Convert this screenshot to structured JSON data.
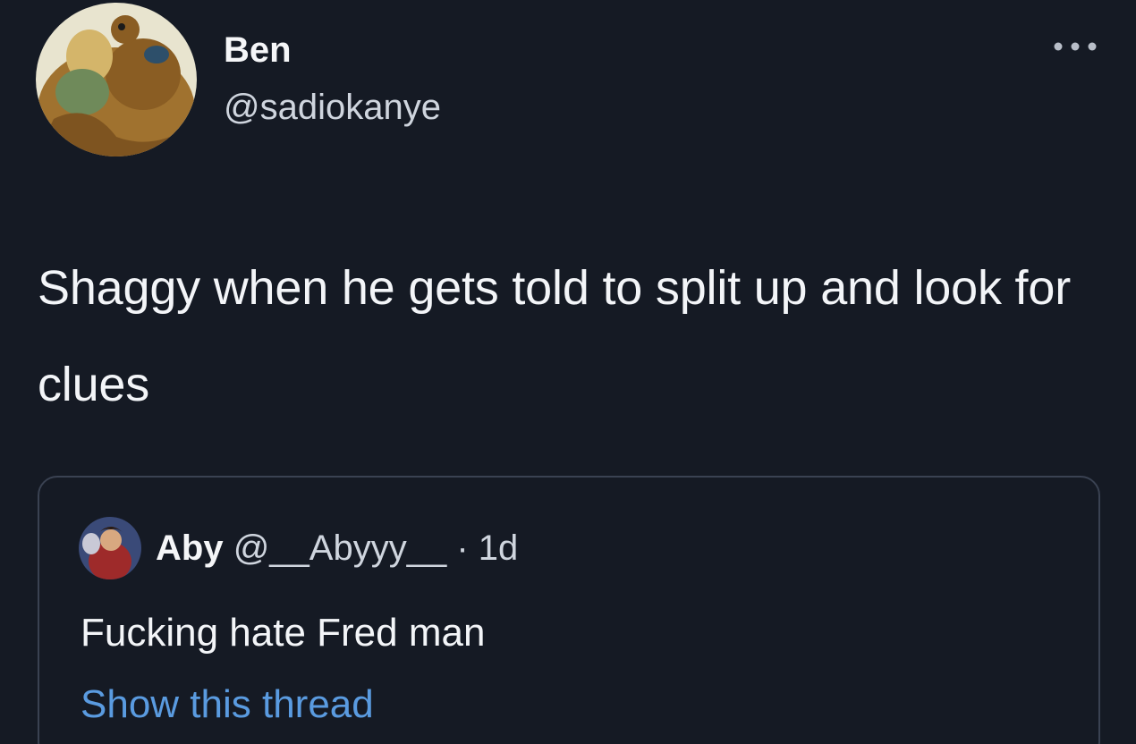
{
  "tweet": {
    "avatar_icon": "scooby-shaggy-avatar-icon",
    "display_name": "Ben",
    "handle": "@sadiokanye",
    "more_icon": "more-options-icon",
    "text": "Shaggy when he gets told to split up and look for clues"
  },
  "quote": {
    "avatar_icon": "aby-avatar-icon",
    "display_name": "Aby",
    "handle": "@__Abyyy__",
    "separator": "·",
    "time": "1d",
    "text": "Fucking hate Fred man",
    "show_thread_label": "Show this thread"
  },
  "colors": {
    "background": "#151a24",
    "link": "#5a9be0",
    "border": "#3a4252"
  }
}
